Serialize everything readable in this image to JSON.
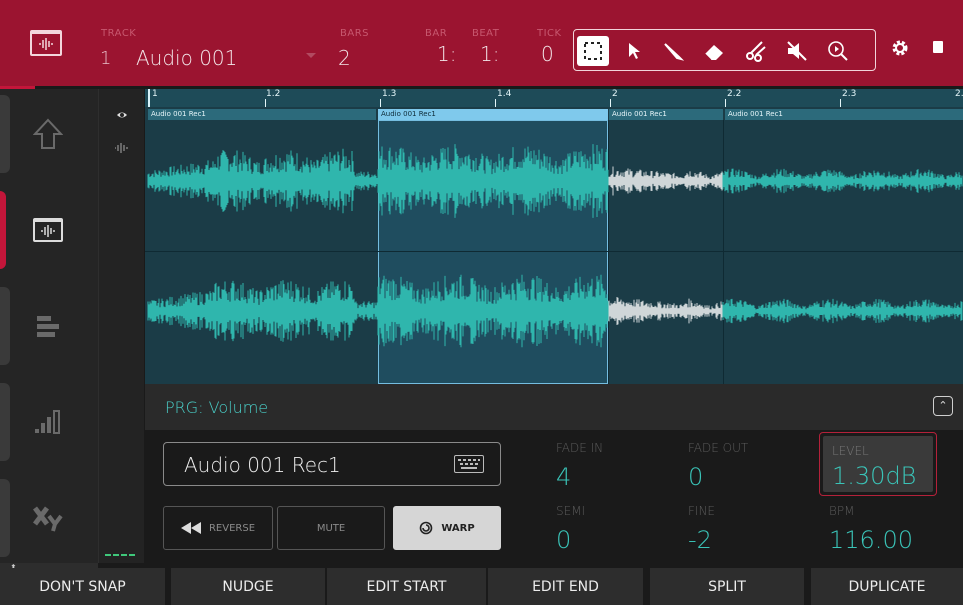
{
  "header": {
    "track_label": "TRACK",
    "track_number": "1",
    "track_name": "Audio 001",
    "bars_label": "BARS",
    "bars_value": "2",
    "bar_label": "BAR",
    "bar_value": "1:",
    "beat_label": "BEAT",
    "beat_value": "1:",
    "tick_label": "TICK",
    "tick_value": "0",
    "tools": [
      "select-box-tool",
      "pointer-tool",
      "pencil-tool",
      "eraser-tool",
      "scissors-tool",
      "mute-tool",
      "zoom-tool"
    ],
    "selected_tool": "select-box-tool"
  },
  "left_rail": {
    "tabs": [
      "arrow-up-icon",
      "track-view-icon",
      "list-view-icon",
      "mixer-levels-icon",
      "xy-icon"
    ],
    "active_tab": 1
  },
  "ruler": {
    "ticks": [
      "1",
      "1.2",
      "1.3",
      "1.4",
      "2",
      "2.2",
      "2.3",
      "2."
    ]
  },
  "regions": [
    {
      "label": "Audio 001 Rec1",
      "selected": false
    },
    {
      "label": "Audio 001 Rec1",
      "selected": true
    },
    {
      "label": "Audio 001 Rec1",
      "selected": false
    },
    {
      "label": "Audio 001 Rec1",
      "selected": false
    }
  ],
  "prg": {
    "label": "PRG: Volume"
  },
  "edit": {
    "region_name": "Audio 001 Rec1",
    "reverse_label": "REVERSE",
    "mute_label": "MUTE",
    "warp_label": "WARP",
    "fade_in_label": "FADE IN",
    "fade_in_value": "4",
    "fade_out_label": "FADE OUT",
    "fade_out_value": "0",
    "level_label": "LEVEL",
    "level_value": "1.30dB",
    "semi_label": "SEMI",
    "semi_value": "0",
    "fine_label": "FINE",
    "fine_value": "-2",
    "bpm_label": "BPM",
    "bpm_value": "116.00"
  },
  "toolbar": {
    "dont_snap": "DON'T SNAP",
    "nudge": "NUDGE",
    "edit_start": "EDIT START",
    "edit_end": "EDIT END",
    "split": "SPLIT",
    "duplicate": "DUPLICATE"
  },
  "colors": {
    "header_bg": "#9b1430",
    "accent_red": "#c3163a",
    "waveform": "#2fb6ad",
    "waveform_selected_part": "#cfd6d8",
    "value_teal": "#3ac4b8"
  }
}
